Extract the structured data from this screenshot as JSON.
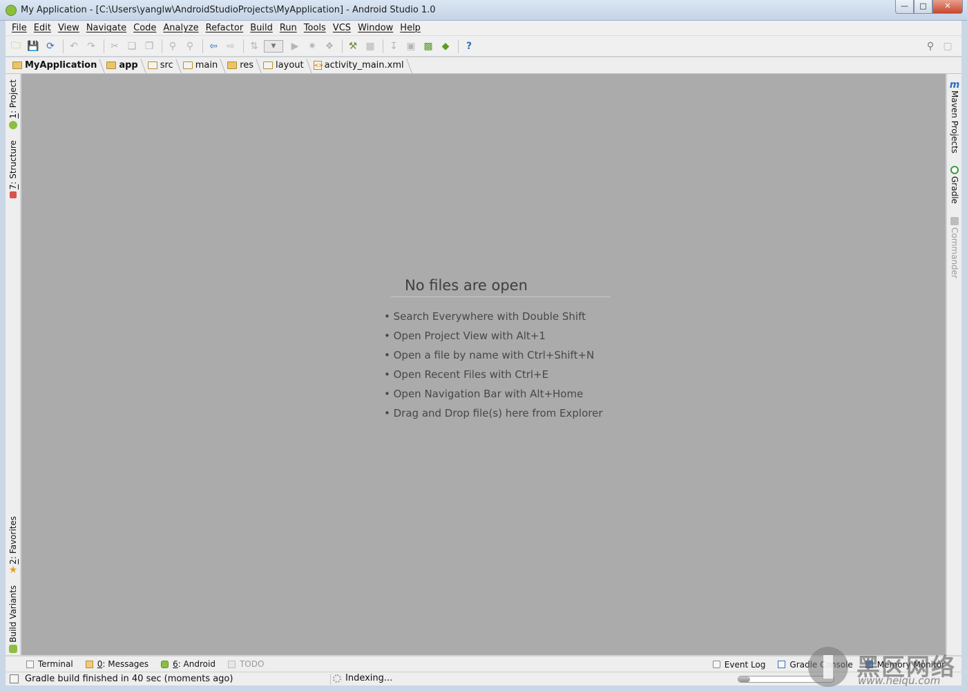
{
  "window": {
    "title": "My Application - [C:\\Users\\yanglw\\AndroidStudioProjects\\MyApplication] - Android Studio 1.0",
    "controls": [
      "minimize",
      "maximize",
      "close"
    ]
  },
  "menubar": {
    "items": [
      "File",
      "Edit",
      "View",
      "Navigate",
      "Code",
      "Analyze",
      "Refactor",
      "Build",
      "Run",
      "Tools",
      "VCS",
      "Window",
      "Help"
    ]
  },
  "toolbar": {
    "icons": [
      "open-icon",
      "save-icon",
      "sync-icon",
      "undo-icon",
      "redo-icon",
      "cut-icon",
      "copy-icon",
      "paste-icon",
      "find-icon",
      "replace-icon",
      "back-icon",
      "forward-icon",
      "make-icon",
      "run-config-combo",
      "run-icon",
      "debug-icon",
      "attach-icon",
      "project-structure-icon",
      "settings-icon",
      "sdk-manager-icon",
      "avd-manager-icon",
      "device-monitor-icon",
      "android-icon",
      "help-icon",
      "search-everywhere-icon",
      "tool-windows-icon"
    ]
  },
  "breadcrumb": {
    "items": [
      {
        "label": "MyApplication",
        "icon": "folder-icon",
        "bold": true
      },
      {
        "label": "app",
        "icon": "module-icon",
        "bold": true
      },
      {
        "label": "src",
        "icon": "folder-icon"
      },
      {
        "label": "main",
        "icon": "folder-icon"
      },
      {
        "label": "res",
        "icon": "folder-icon"
      },
      {
        "label": "layout",
        "icon": "folder-icon"
      },
      {
        "label": "activity_main.xml",
        "icon": "xml-file-icon"
      }
    ]
  },
  "left_stripe": {
    "project": {
      "number": "1",
      "label": ": Project"
    },
    "structure": {
      "number": "7",
      "label": ": Structure"
    },
    "favorites": {
      "number": "2",
      "label": ": Favorites"
    },
    "build_variants": {
      "label": "Build Variants"
    }
  },
  "right_stripe": {
    "maven": {
      "label": "Maven Projects",
      "icon_letter": "m"
    },
    "gradle": {
      "label": "Gradle"
    },
    "commander": {
      "label": "Commander"
    }
  },
  "editor": {
    "empty_title": "No files are open",
    "hints": [
      "Search Everywhere with Double Shift",
      "Open Project View with Alt+1",
      "Open a file by name with Ctrl+Shift+N",
      "Open Recent Files with Ctrl+E",
      "Open Navigation Bar with Alt+Home",
      "Drag and Drop file(s) here from Explorer"
    ]
  },
  "bottom_tabs": {
    "terminal": {
      "label": "Terminal"
    },
    "messages": {
      "number": "0",
      "label": ": Messages"
    },
    "android": {
      "number": "6",
      "label": ": Android"
    },
    "todo": {
      "label": "TODO"
    },
    "event_log": {
      "label": "Event Log"
    },
    "gradle_console": {
      "label": "Gradle Console"
    },
    "memory_monitor": {
      "label": "Memory Monitor"
    }
  },
  "statusbar": {
    "message": "Gradle build finished in 40 sec (moments ago)",
    "indexing": "Indexing...",
    "progress_fraction": 0.12
  },
  "watermark": {
    "title": "黑区网络",
    "url": "www.heiqu.com"
  },
  "colors": {
    "editor_bg": "#ababab",
    "chrome_bg": "#eeeeee",
    "accent_blue": "#2f6fbf",
    "android_green": "#8cbf3f"
  }
}
